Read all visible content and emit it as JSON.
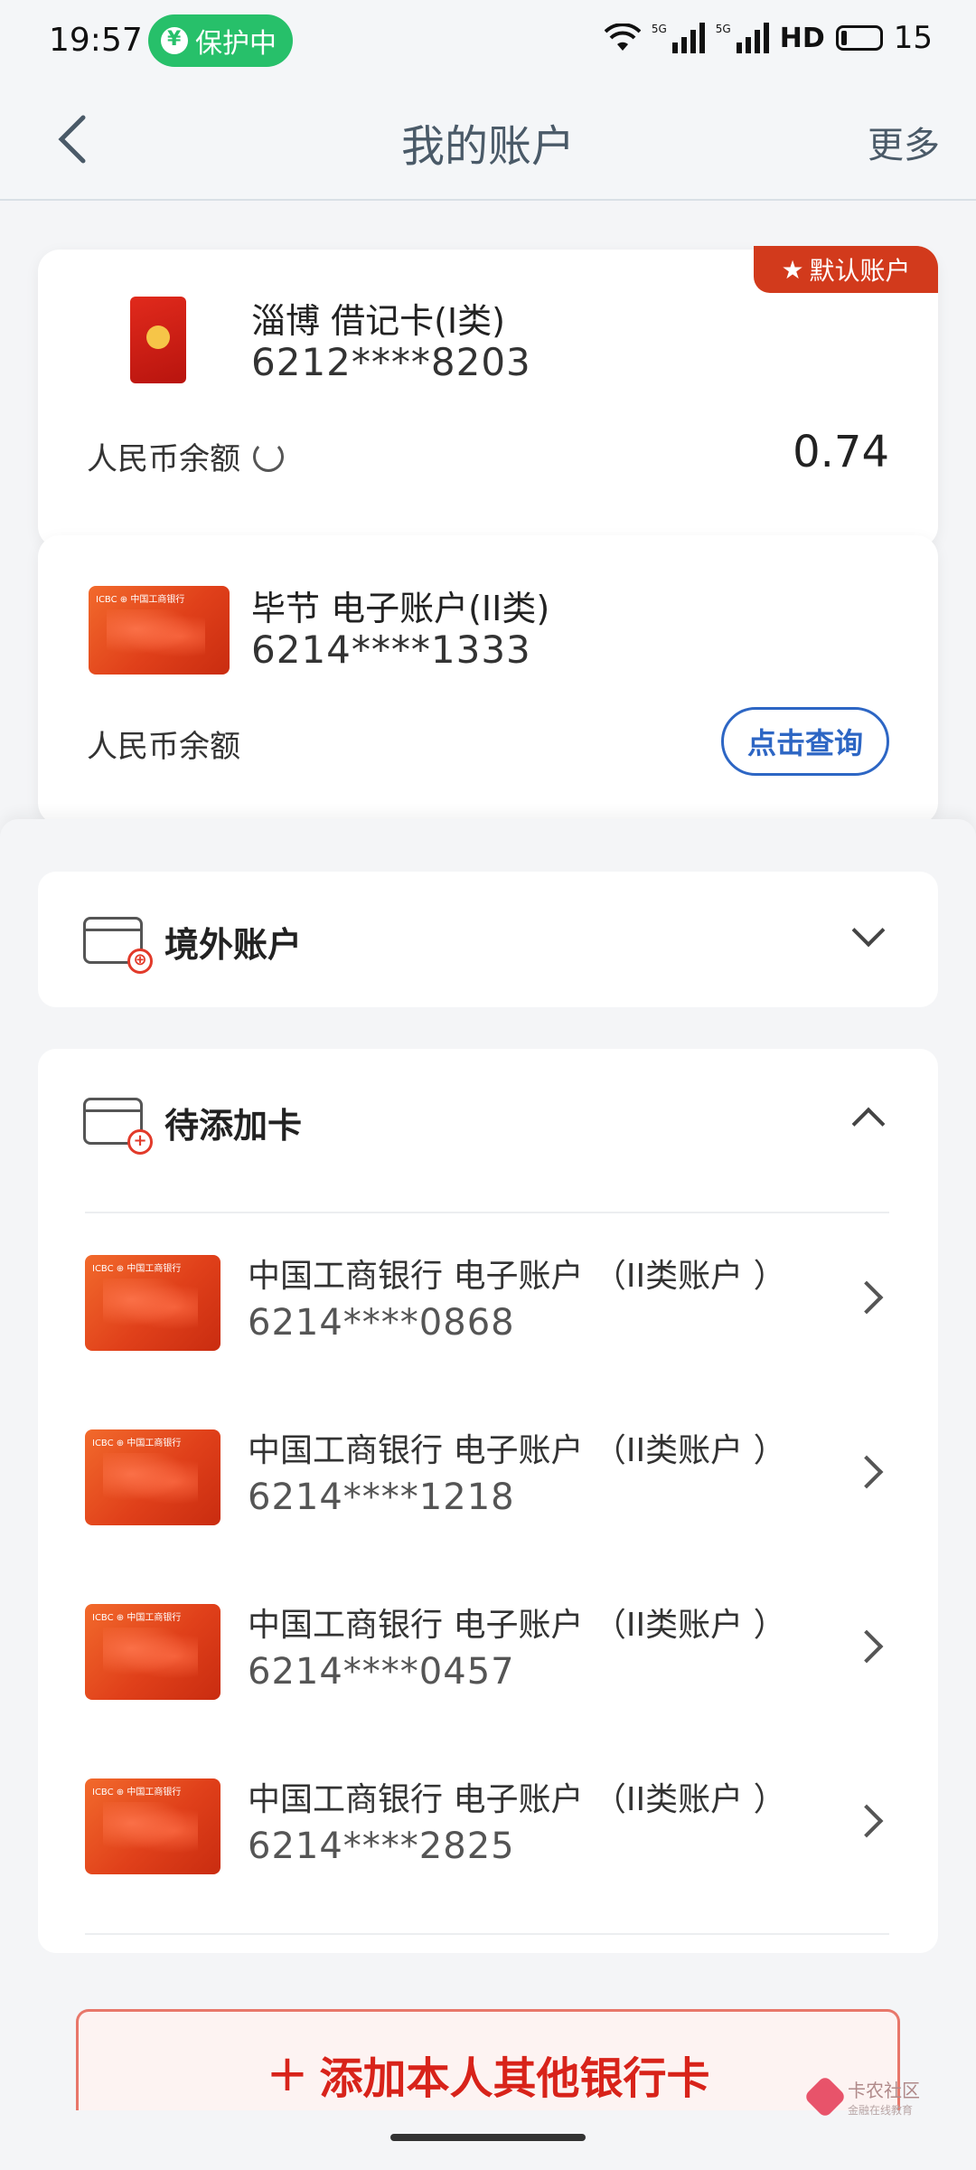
{
  "status_bar": {
    "time": "19:57",
    "protect": "保护中",
    "signal1": "5G",
    "signal2": "5G",
    "hd": "HD",
    "battery": "15"
  },
  "header": {
    "title": "我的账户",
    "more": "更多"
  },
  "accounts": [
    {
      "name": "淄博 借记卡(I类)",
      "number": "6212****8203",
      "balance_label": "人民币余额",
      "balance": "0.74",
      "badge": "默认账户"
    },
    {
      "name": "毕节 电子账户(II类)",
      "number": "6214****1333",
      "balance_label": "人民币余额",
      "query_label": "点击查询"
    }
  ],
  "overseas": {
    "title": "境外账户"
  },
  "pending": {
    "title": "待添加卡",
    "items": [
      {
        "name": "中国工商银行  电子账户 （II类账户 ）",
        "number": "6214****0868"
      },
      {
        "name": "中国工商银行  电子账户 （II类账户 ）",
        "number": "6214****1218"
      },
      {
        "name": "中国工商银行  电子账户 （II类账户 ）",
        "number": "6214****0457"
      },
      {
        "name": "中国工商银行  电子账户 （II类账户 ）",
        "number": "6214****2825"
      }
    ]
  },
  "add_button": {
    "label": "添加本人其他银行卡",
    "plus": "+"
  },
  "watermark": {
    "title": "卡农社区",
    "sub": "金融在线教育"
  },
  "colors": {
    "accent_red": "#d8231a",
    "link_blue": "#2d66c4",
    "protect_green": "#27c06a"
  }
}
